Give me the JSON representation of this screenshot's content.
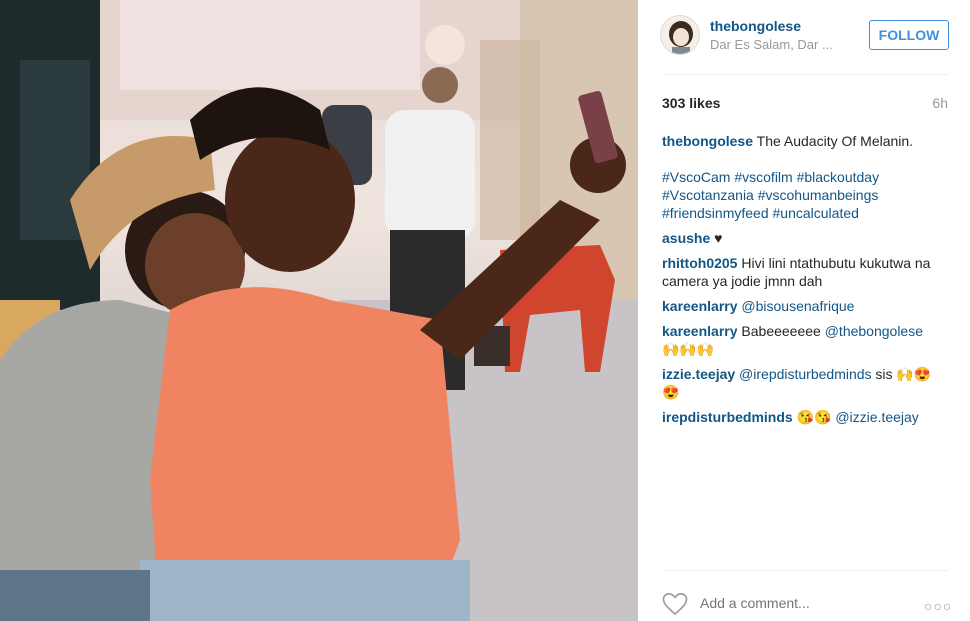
{
  "post": {
    "photo_alt": "",
    "author": {
      "username": "thebongolese",
      "location": "Dar Es Salam, Dar ...",
      "follow_label": "FOLLOW"
    },
    "likes": "303 likes",
    "time_ago": "6h",
    "caption": {
      "username": "thebongolese",
      "text": "The Audacity Of Melanin.",
      "hashtags": "#VscoCam #vscofilm #blackoutday #Vscotanzania #vscohumanbeings #friendsinmyfeed #uncalculated"
    },
    "comments": [
      {
        "username": "asushe",
        "text": "♥",
        "mention": ""
      },
      {
        "username": "rhittoh0205",
        "text": "Hivi lini ntathubutu kukutwa na camera ya jodie jmnn dah",
        "mention": ""
      },
      {
        "username": "kareenlarry",
        "text": "",
        "mention": "@bisousenafrique"
      },
      {
        "username": "kareenlarry",
        "text": "Babeeeeeee ",
        "mention": "@thebongolese",
        "emoji": "🙌🙌🙌"
      },
      {
        "username": "izzie.teejay",
        "text": " sis 🙌😍 😍",
        "mention": "@irepdisturbedminds"
      },
      {
        "username": "irepdisturbedminds",
        "text": "😘😘 ",
        "mention": "@izzie.teejay"
      }
    ],
    "add_comment_placeholder": "Add a comment...",
    "more_label": "○○○"
  },
  "icons": {
    "like": "heart-icon",
    "more": "more-options-icon"
  },
  "colors": {
    "link": "#125688",
    "follow": "#4090db",
    "muted": "#999999",
    "text": "#262626"
  }
}
